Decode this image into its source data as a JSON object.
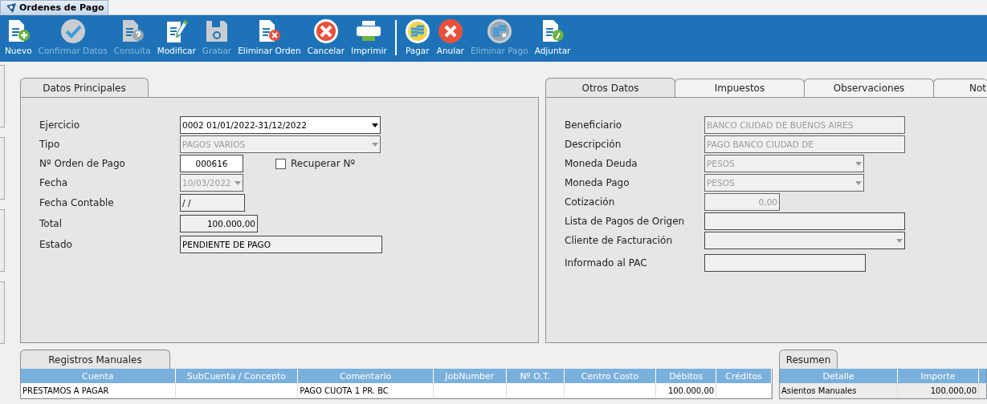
{
  "window": {
    "tab": "Ordenes de Pago"
  },
  "toolbar": [
    {
      "label": "Nuevo",
      "disabled": false
    },
    {
      "label": "Confirmar Datos",
      "disabled": true
    },
    {
      "label": "Consulta",
      "disabled": true
    },
    {
      "label": "Modificar",
      "disabled": false
    },
    {
      "label": "Grabar",
      "disabled": true
    },
    {
      "label": "Eliminar Orden",
      "disabled": false
    },
    {
      "label": "Cancelar",
      "disabled": false
    },
    {
      "label": "Imprimir",
      "disabled": false
    },
    {
      "label": "Pagar",
      "disabled": false
    },
    {
      "label": "Anular",
      "disabled": false
    },
    {
      "label": "Eliminar Pago",
      "disabled": true
    },
    {
      "label": "Adjuntar",
      "disabled": false
    }
  ],
  "main_panel": {
    "tabs": [
      {
        "label": "Datos Principales",
        "selected": true
      }
    ],
    "fields": [
      {
        "label": "Ejercicio",
        "kind": "combo",
        "editable": true,
        "disabled": false,
        "value": "0002 01/01/2022-31/12/2022"
      },
      {
        "label": "Tipo",
        "kind": "combo",
        "editable": false,
        "disabled": true,
        "value": "PAGOS VARIOS"
      },
      {
        "label": "Nº Orden de Pago",
        "kind": "text",
        "editable": true,
        "disabled": false,
        "value": "000616",
        "checkbox": {
          "label": "Recuperar Nº",
          "checked": false
        }
      },
      {
        "label": "Fecha",
        "kind": "combo",
        "editable": false,
        "disabled": true,
        "value": "10/03/2022"
      },
      {
        "label": "Fecha Contable",
        "kind": "text",
        "editable": false,
        "disabled": false,
        "value": " /  /"
      },
      {
        "label": "Total",
        "kind": "text",
        "editable": false,
        "disabled": false,
        "value": "100.000,00"
      },
      {
        "label": "Estado",
        "kind": "text",
        "editable": false,
        "disabled": false,
        "value": "PENDIENTE DE PAGO"
      }
    ]
  },
  "side_panel": {
    "tabs": [
      {
        "label": "Otros Datos",
        "selected": true
      },
      {
        "label": "Impuestos",
        "selected": false
      },
      {
        "label": "Observaciones",
        "selected": false
      },
      {
        "label": "Not",
        "selected": false
      }
    ],
    "fields": [
      {
        "label": "Beneficiario",
        "kind": "text",
        "editable": false,
        "disabled": true,
        "value": "BANCO CIUDAD DE BUENOS AIRES"
      },
      {
        "label": "Descripción",
        "kind": "text",
        "editable": false,
        "disabled": true,
        "value": "PAGO BANCO CIUDAD DE"
      },
      {
        "label": "Moneda Deuda",
        "kind": "combo",
        "editable": false,
        "disabled": true,
        "value": "PESOS"
      },
      {
        "label": "Moneda Pago",
        "kind": "combo",
        "editable": false,
        "disabled": true,
        "value": "PESOS"
      },
      {
        "label": "Cotización",
        "kind": "text",
        "editable": false,
        "disabled": true,
        "value": "0,00"
      },
      {
        "label": "Lista de Pagos de Origen",
        "kind": "text",
        "editable": false,
        "disabled": false
      },
      {
        "label": "Cliente de Facturación",
        "kind": "combo",
        "editable": false,
        "disabled": false
      },
      {
        "label": "Informado al PAC",
        "kind": "text",
        "editable": false,
        "disabled": false
      }
    ]
  },
  "registros": {
    "tabs": [
      {
        "label": "Registros Manuales",
        "selected": true
      }
    ],
    "columns": [
      "Cuenta",
      "SubCuenta / Concepto",
      "Comentario",
      "JobNumber",
      "Nº O.T.",
      "Centro Costo",
      "Débitos",
      "Créditos"
    ],
    "rows": [
      {
        "cells": [
          "PRESTAMOS A PAGAR",
          null,
          "PAGO CUOTA 1 PR. BC",
          null,
          null,
          null,
          "100.000,00",
          null
        ]
      }
    ]
  },
  "resumen": {
    "tabs": [
      {
        "label": "Resumen",
        "selected": true
      }
    ],
    "columns": [
      "Detalle",
      "Importe"
    ],
    "rows": [
      {
        "cells": [
          "Asientos Manuales",
          "100.000,00"
        ]
      }
    ]
  }
}
